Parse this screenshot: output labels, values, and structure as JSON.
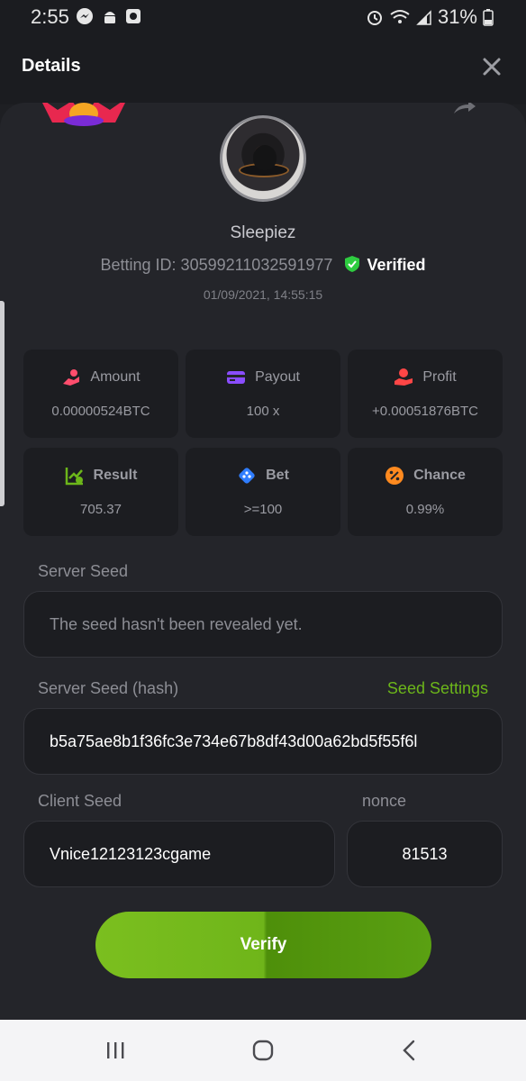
{
  "status_bar": {
    "time": "2:55",
    "battery": "31%"
  },
  "header": {
    "title": "Details"
  },
  "profile": {
    "username": "Sleepiez",
    "betting_id_label": "Betting ID: 30599211032591977",
    "verified_label": "Verified",
    "timestamp": "01/09/2021, 14:55:15"
  },
  "stats": [
    {
      "label": "Amount",
      "value": "0.00000524BTC",
      "icon": "hand-coin-icon",
      "color": "#ff4d6d"
    },
    {
      "label": "Payout",
      "value": "100 x",
      "icon": "card-icon",
      "color": "#8a4dff"
    },
    {
      "label": "Profit",
      "value": "+0.00051876BTC",
      "icon": "hand-profit-icon",
      "color": "#ff4646"
    },
    {
      "label": "Result",
      "value": "705.37",
      "icon": "chart-check-icon",
      "color": "#6cb61a"
    },
    {
      "label": "Bet",
      "value": ">=100",
      "icon": "dice-icon",
      "color": "#2f7dff"
    },
    {
      "label": "Chance",
      "value": "0.99%",
      "icon": "percent-icon",
      "color": "#ff8a1f"
    }
  ],
  "server_seed": {
    "label": "Server Seed",
    "value": "The seed hasn't been revealed yet."
  },
  "server_seed_hash": {
    "label": "Server Seed (hash)",
    "settings_link": "Seed Settings",
    "value": "b5a75ae8b1f36fc3e734e67b8df43d00a62bd5f55f6l"
  },
  "client_seed": {
    "label": "Client Seed",
    "value": "Vnice12123123cgame"
  },
  "nonce": {
    "label": "nonce",
    "value": "81513"
  },
  "verify_button": {
    "label": "Verify"
  },
  "colors": {
    "accent_green": "#6cb61a",
    "verified_green": "#2ecc40",
    "background": "#1e1f23",
    "sheet": "#24252a",
    "card": "#1c1d21"
  }
}
